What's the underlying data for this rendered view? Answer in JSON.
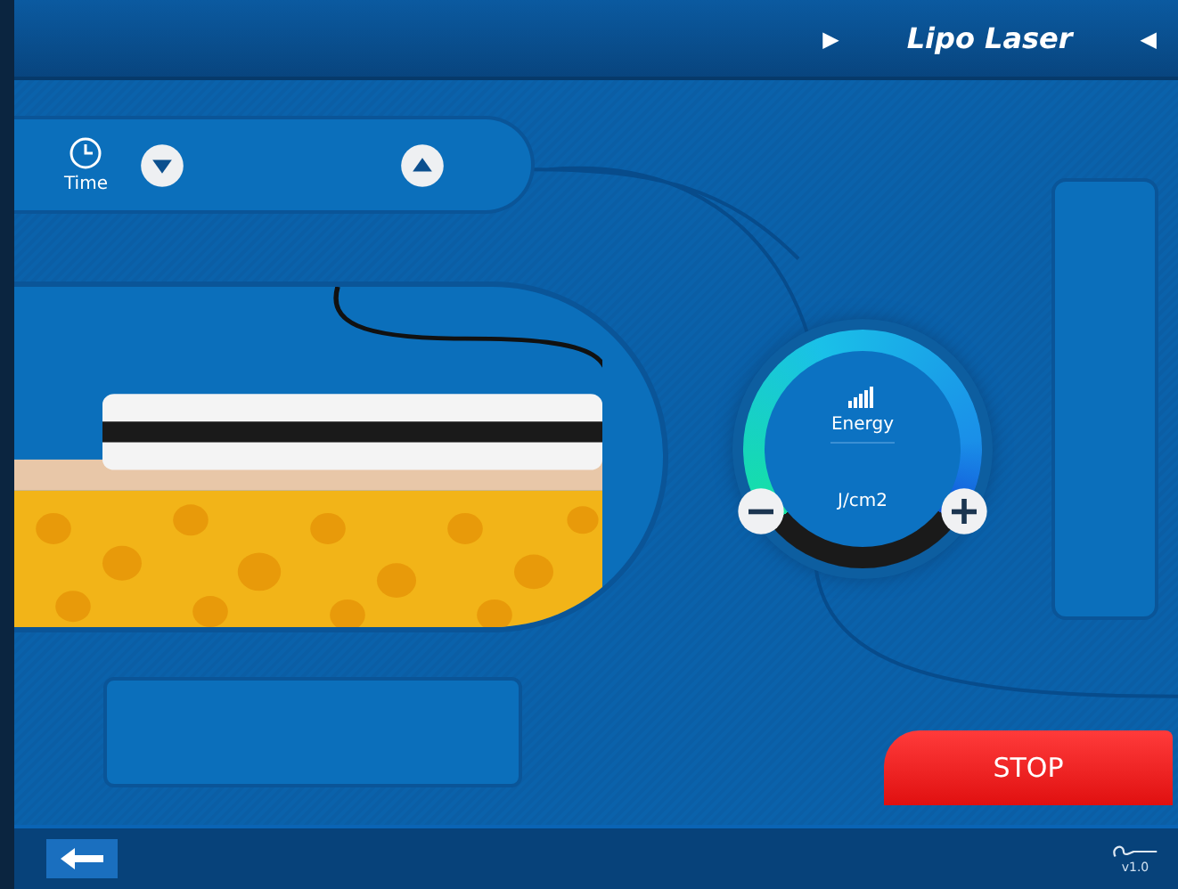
{
  "header": {
    "prev_arrow": "▶",
    "title": "Lipo Laser",
    "next_arrow": "◀"
  },
  "time_control": {
    "label": "Time"
  },
  "energy_dial": {
    "label": "Energy",
    "unit": "J/cm2"
  },
  "stop_button": {
    "label": "STOP"
  },
  "footer": {
    "version": "v1.0"
  }
}
